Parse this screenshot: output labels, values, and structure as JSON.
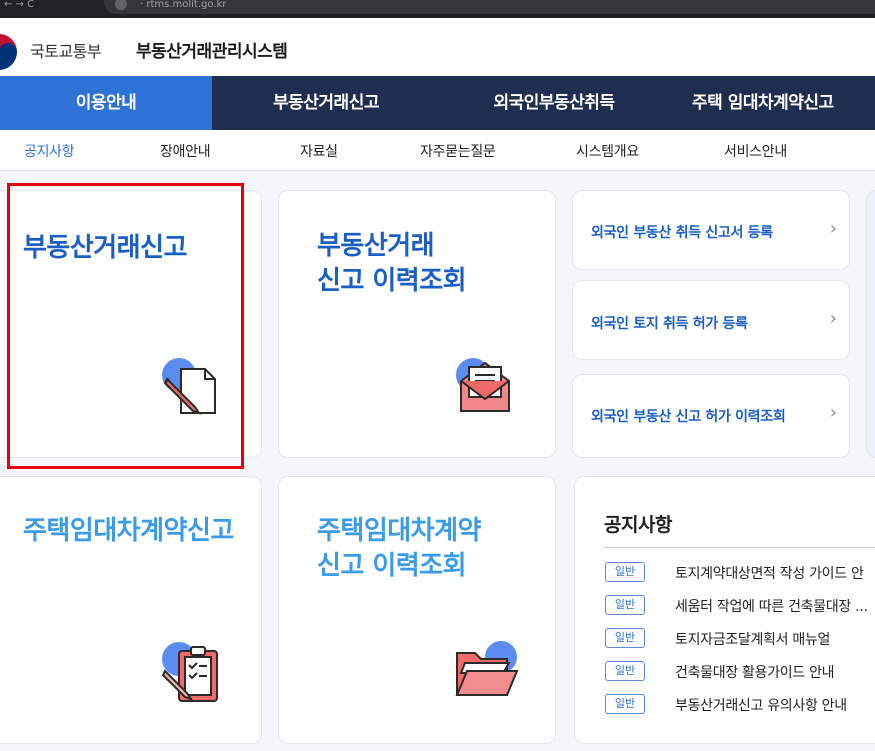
{
  "browser": {
    "left_text": "←  →  C",
    "url_fragment": "· rtms.molit.go.kr"
  },
  "header": {
    "ministry": "국토교통부",
    "system_title": "부동산거래관리시스템"
  },
  "main_nav": [
    "이용안내",
    "부동산거래신고",
    "외국인부동산취득",
    "주택 임대차계약신고"
  ],
  "sub_nav": [
    "공지사항",
    "장애안내",
    "자료실",
    "자주묻는질문",
    "시스템개요",
    "서비스안내"
  ],
  "cards": {
    "report": {
      "title": "부동산거래신고",
      "icon": "document-pen-icon"
    },
    "history": {
      "title_line1": "부동산거래",
      "title_line2": "신고 이력조회",
      "icon": "mail-envelope-icon"
    },
    "lease_report": {
      "title": "주택임대차계약신고",
      "icon": "clipboard-pen-icon"
    },
    "lease_history": {
      "title_line1": "주택임대차계약",
      "title_line2": "신고 이력조회",
      "icon": "folder-icon"
    }
  },
  "foreign_links": [
    "외국인 부동산 취득 신고서 등록",
    "외국인 토지 취득 허가 등록",
    "외국인 부동산 신고 허가 이력조회"
  ],
  "notices": {
    "title": "공지사항",
    "items": [
      {
        "badge": "일반",
        "text": "토지계약대상면적 작성 가이드 안"
      },
      {
        "badge": "일반",
        "text": "세움터 작업에 따른 건축물대장 ..."
      },
      {
        "badge": "일반",
        "text": "토지자금조달계획서 매뉴얼"
      },
      {
        "badge": "일반",
        "text": "건축물대장 활용가이드 안내"
      },
      {
        "badge": "일반",
        "text": "부동산거래신고 유의사항 안내"
      }
    ]
  },
  "colors": {
    "nav_bg": "#1f2e4f",
    "nav_active": "#2f72d6",
    "highlight": "#e60012",
    "title_blue": "#1a5fc5",
    "title_light": "#3a9be8"
  }
}
